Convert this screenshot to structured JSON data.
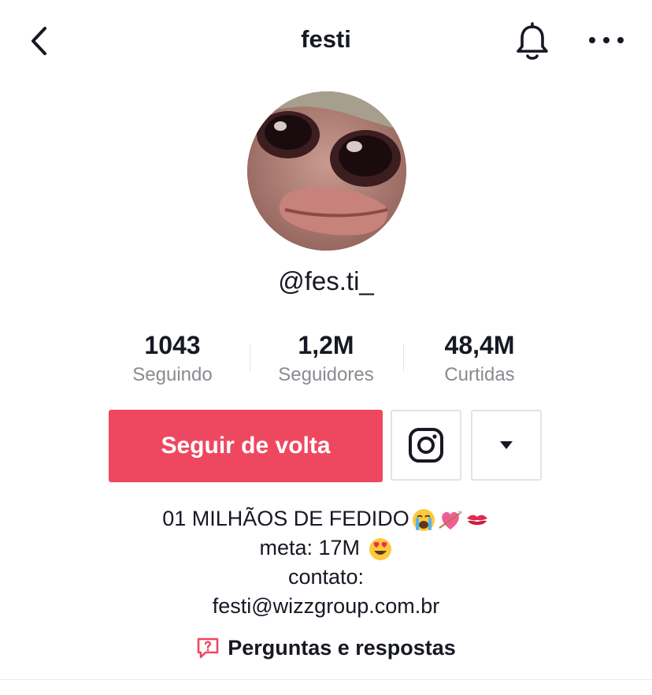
{
  "header": {
    "title": "festi",
    "back_icon": "chevron-left-icon",
    "bell_icon": "bell-icon",
    "more_icon": "more-horizontal-icon"
  },
  "profile": {
    "username": "@fes.ti_",
    "avatar": "avatar-image"
  },
  "stats": [
    {
      "value": "1043",
      "label": "Seguindo"
    },
    {
      "value": "1,2M",
      "label": "Seguidores"
    },
    {
      "value": "48,4M",
      "label": "Curtidas"
    }
  ],
  "actions": {
    "follow_label": "Seguir de volta",
    "instagram_icon": "instagram-icon",
    "dropdown_icon": "caret-down-icon",
    "accent_color": "#ee4860"
  },
  "bio": {
    "line1": "01 MILHÃOS DE FEDIDO",
    "line2": "meta: 17M ",
    "line3": "contato:",
    "line4": "festi@wizzgroup.com.br",
    "line1_emojis": [
      "crying-face-emoji",
      "heart-with-arrow-emoji",
      "kiss-mark-emoji"
    ],
    "line2_emoji": "heart-eyes-emoji"
  },
  "qa": {
    "label": "Perguntas e respostas",
    "icon": "question-bubble-icon",
    "icon_color": "#ee4860"
  }
}
